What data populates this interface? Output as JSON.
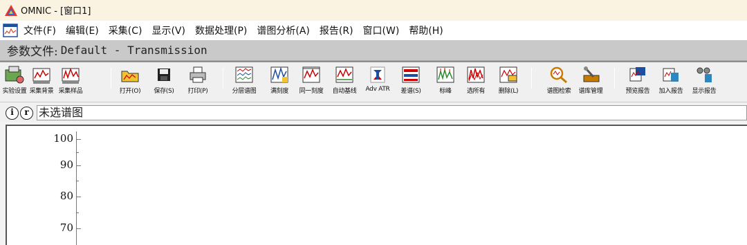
{
  "window": {
    "title": "OMNIC - [窗口1]"
  },
  "menu": [
    "文件(F)",
    "编辑(E)",
    "采集(C)",
    "显示(V)",
    "数据处理(P)",
    "谱图分析(A)",
    "报告(R)",
    "窗口(W)",
    "帮助(H)"
  ],
  "param": {
    "label": "参数文件:",
    "value": "Default - Transmission"
  },
  "toolbar": [
    {
      "label": "实验设置",
      "icon": "experiment-setup-icon"
    },
    {
      "label": "采集背景",
      "icon": "collect-background-icon"
    },
    {
      "label": "采集样品",
      "icon": "collect-sample-icon"
    },
    {
      "label": "打开(O)",
      "icon": "open-folder-icon"
    },
    {
      "label": "保存(S)",
      "icon": "save-disk-icon"
    },
    {
      "label": "打印(P)",
      "icon": "printer-icon"
    },
    {
      "label": "分层谱图",
      "icon": "stacked-spectra-icon"
    },
    {
      "label": "满刻度",
      "icon": "full-scale-icon"
    },
    {
      "label": "同一刻度",
      "icon": "common-scale-icon"
    },
    {
      "label": "自动基线",
      "icon": "auto-baseline-icon"
    },
    {
      "label": "Adv ATR",
      "icon": "advanced-atr-icon"
    },
    {
      "label": "差谱(S)",
      "icon": "subtract-spectra-icon"
    },
    {
      "label": "标峰",
      "icon": "find-peaks-icon"
    },
    {
      "label": "选所有",
      "icon": "select-all-icon"
    },
    {
      "label": "删除(L)",
      "icon": "delete-icon"
    },
    {
      "label": "谱图检索",
      "icon": "spectrum-search-icon"
    },
    {
      "label": "谱库管理",
      "icon": "library-manager-icon"
    },
    {
      "label": "预览报告",
      "icon": "preview-report-icon"
    },
    {
      "label": "加入报告",
      "icon": "add-to-report-icon"
    },
    {
      "label": "显示报告",
      "icon": "view-report-icon"
    }
  ],
  "info": {
    "i_button": "i",
    "r_button": "r",
    "spectrum_title": "未选谱图"
  },
  "plot": {
    "y_ticks": [
      "100",
      "90",
      "80",
      "70"
    ]
  }
}
